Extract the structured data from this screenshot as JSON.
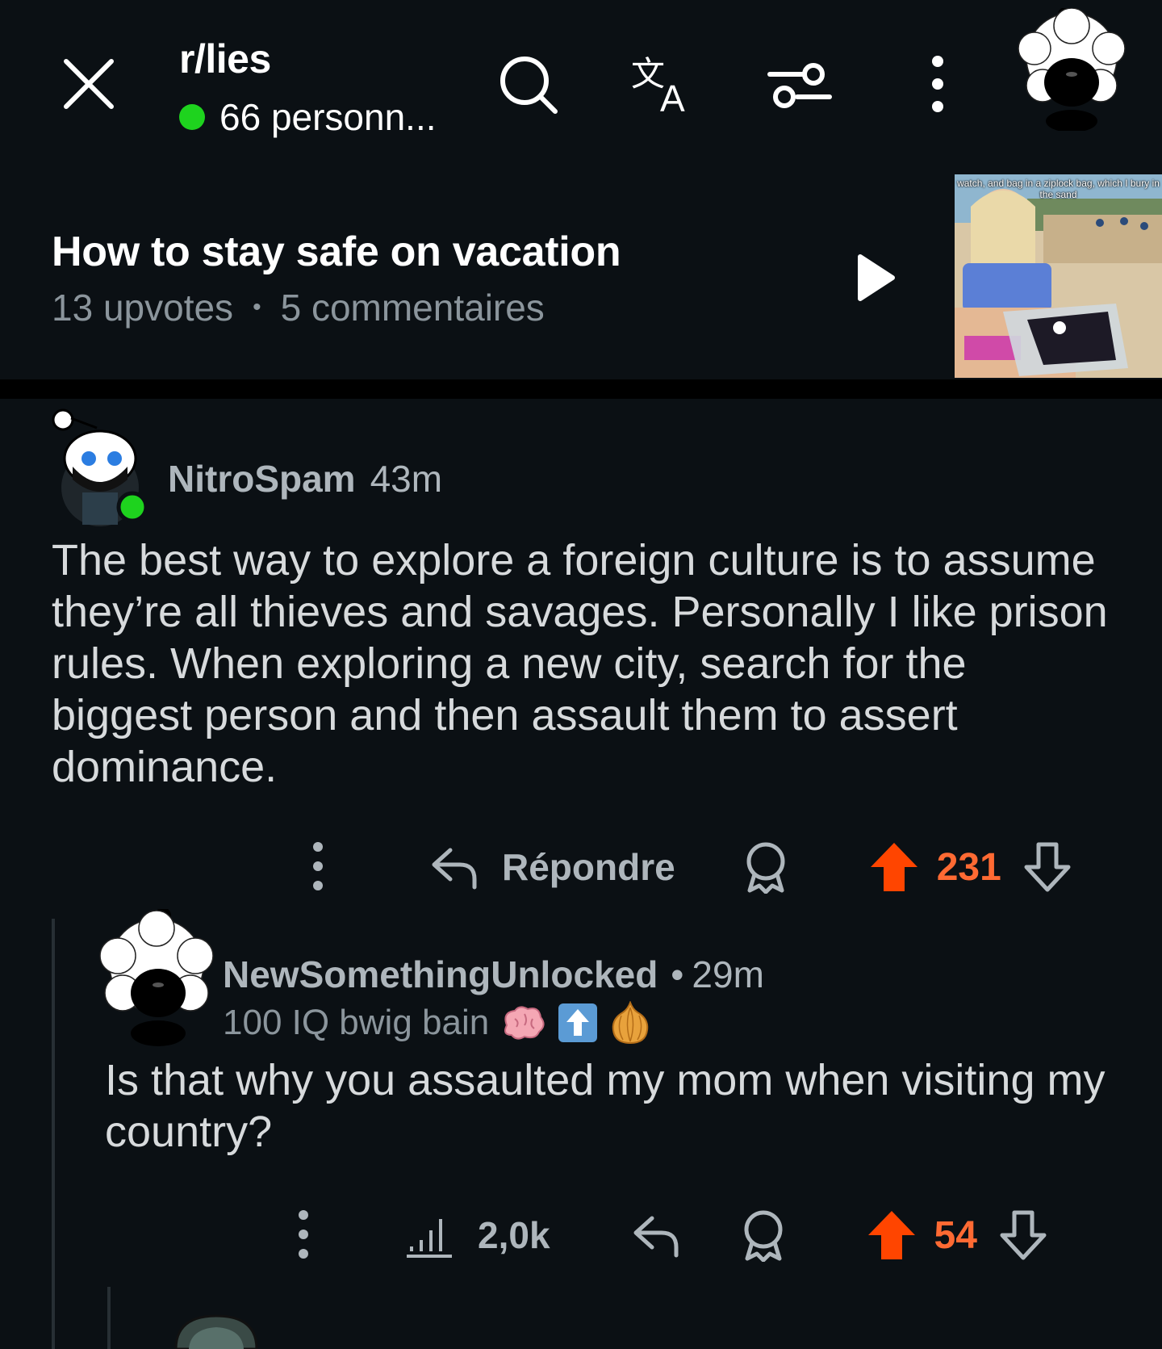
{
  "header": {
    "close_icon": "close-icon",
    "subreddit": "r/lies",
    "online_count": "66 personn...",
    "online_color": "#1ed31e",
    "icons": [
      "search-icon",
      "translate-icon",
      "filter-icon",
      "more-vertical-icon"
    ]
  },
  "post": {
    "title": "How to stay safe on vacation",
    "upvotes": "13 upvotes",
    "separator": "•",
    "comments": "5 commentaires",
    "thumbnail_caption": "watch, and bag in a ziplock bag, which I bury in the sand"
  },
  "comments": [
    {
      "author": "NitroSpam",
      "time": "43m",
      "body": "The best way to explore a foreign culture is to assume they’re all thieves and savages. Personally I like prison rules. When exploring a new city, search for the biggest person and then assault them to assert dominance.",
      "reply_label": "Répondre",
      "votes": "231"
    },
    {
      "author": "NewSomethingUnlocked",
      "separator": "•",
      "time": "29m",
      "flair": "100 IQ bwig bain",
      "flair_emojis": [
        "brain-emoji",
        "up-arrow-emoji",
        "onion-emoji"
      ],
      "body": "Is that why you assaulted my mom when visiting my country?",
      "views": "2,0k",
      "votes": "54"
    }
  ],
  "colors": {
    "background": "#0b1014",
    "upvote_active": "#ff4500",
    "vote_count": "#ff6a33",
    "muted_text": "#8b959c"
  }
}
